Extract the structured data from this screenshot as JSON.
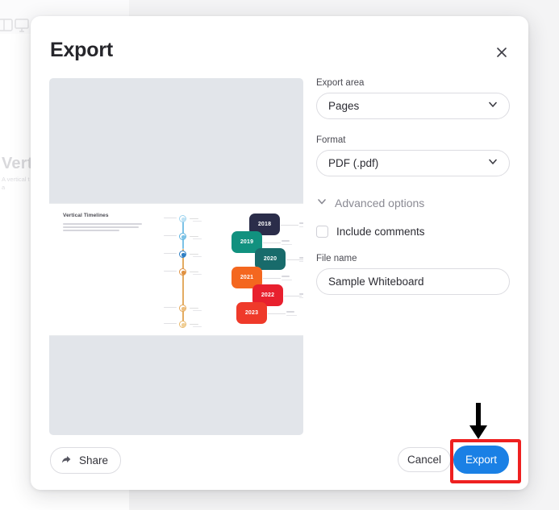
{
  "background": {
    "toolbar_icons": [
      "panel-icon",
      "presentation-screen-icon"
    ],
    "canvas_heading": "Verti",
    "canvas_paragraph": "A vertical t sequence u bottom of a"
  },
  "dialog": {
    "title": "Export",
    "close_icon": "close-icon"
  },
  "preview": {
    "page_title": "Vertical Timelines",
    "timeline": {
      "nodes": [
        {
          "color": "#9ed4ef",
          "rail": "#9ed4ef"
        },
        {
          "color": "#5fb4e0",
          "rail": "#5fb4e0"
        },
        {
          "color": "#2f7fc4",
          "rail": "#2f7fc4"
        },
        {
          "color": "#e09140",
          "rail": "#e5a860"
        },
        {
          "color": "#e4a759",
          "rail": "#e5b070"
        },
        {
          "color": "#e9b96b",
          "rail": "#e9b96b"
        }
      ]
    },
    "year_cards": [
      {
        "year": "2018",
        "color": "#2b2d4a"
      },
      {
        "year": "2019",
        "color": "#11917f"
      },
      {
        "year": "2020",
        "color": "#186b6b"
      },
      {
        "year": "2021",
        "color": "#f4671f"
      },
      {
        "year": "2022",
        "color": "#e8202e"
      },
      {
        "year": "2023",
        "color": "#ef3a2a"
      }
    ],
    "card_label": "Title"
  },
  "form": {
    "export_area": {
      "label": "Export area",
      "value": "Pages",
      "chevron_icon": "chevron-down-icon"
    },
    "format": {
      "label": "Format",
      "value": "PDF (.pdf)",
      "chevron_icon": "chevron-down-icon"
    },
    "advanced_options": {
      "label": "Advanced options",
      "chevron_icon": "chevron-down-icon"
    },
    "include_comments": {
      "label": "Include comments",
      "checked": false
    },
    "file_name": {
      "label": "File name",
      "value": "Sample Whiteboard",
      "placeholder": "File name"
    }
  },
  "footer": {
    "share_label": "Share",
    "share_icon": "share-arrow-icon",
    "cancel_label": "Cancel",
    "export_label": "Export"
  },
  "annotation": {
    "highlight_color": "#ee2020",
    "arrow_color": "#000000",
    "target": "export-button"
  },
  "colors": {
    "accent_blue": "#1a80e5",
    "dialog_background": "#ffffff",
    "preview_background": "#e2e5ea",
    "page_background": "#f4f4f5"
  }
}
